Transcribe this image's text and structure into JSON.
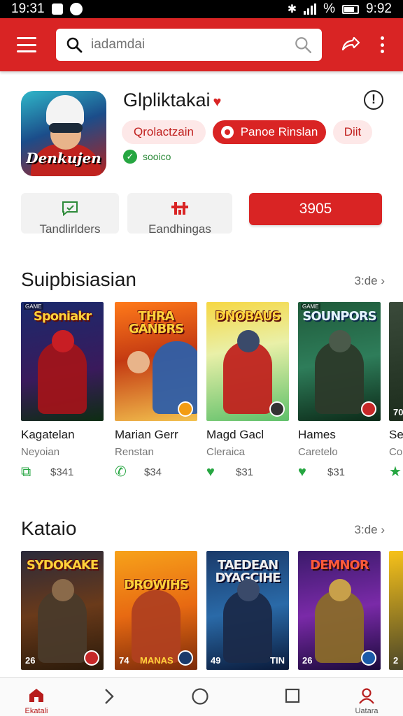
{
  "status_bar": {
    "time": "19:31",
    "battery_text": "%",
    "right_time": "9:92"
  },
  "search": {
    "placeholder": "iadamdai"
  },
  "app": {
    "name": "Glpliktakai",
    "icon_text": "Denkujen",
    "chips": [
      "Qrolactzain",
      "Panoe Rinslan",
      "Diit"
    ],
    "verified_label": "sooico"
  },
  "actions": [
    {
      "label": "Tandlirlders",
      "icon": "chat-icon"
    },
    {
      "label": "Eandhingas",
      "icon": "grid-icon"
    },
    {
      "label": "3905"
    }
  ],
  "sections": [
    {
      "title": "Suipbisiasian",
      "more": "3:de",
      "items": [
        {
          "cover_title": "Sponiakr",
          "name": "Kagatelan",
          "sub": "Neyoian",
          "price": "$341",
          "icon": "tablet-icon"
        },
        {
          "cover_title": "THRA GANBRS",
          "name": "Marian Gerr",
          "sub": "Renstan",
          "price": "$34",
          "icon": "phone-icon"
        },
        {
          "cover_title": "DNOBAUS",
          "name": "Magd Gacl",
          "sub": "Cleraica",
          "price": "$31",
          "icon": "heart-icon"
        },
        {
          "cover_title": "SOUNPORS",
          "name": "Hames",
          "sub": "Caretelo",
          "price": "$31",
          "icon": "heart-icon"
        },
        {
          "cover_title": "70",
          "name": "Se",
          "sub": "Co",
          "price": "",
          "icon": "star-icon"
        }
      ]
    },
    {
      "title": "Kataio",
      "more": "3:de",
      "items": [
        {
          "cover_title": "SYDOKAKE",
          "rank": "26",
          "icon": ""
        },
        {
          "cover_title": "DROWIHS",
          "rank": "74",
          "footer": "MANAS"
        },
        {
          "cover_title": "TAEDEAN DYAGCIHE",
          "rank": "49",
          "footer": "TIN"
        },
        {
          "cover_title": "DEMNOR",
          "rank": "26"
        },
        {
          "cover_title": "S",
          "rank": "2"
        }
      ]
    }
  ],
  "bottom_nav": [
    {
      "label": "Ekatali",
      "icon": "home-icon"
    },
    {
      "label": "",
      "icon": "chevron-right-icon"
    },
    {
      "label": "",
      "icon": "circle-icon"
    },
    {
      "label": "",
      "icon": "square-icon"
    },
    {
      "label": "Uatara",
      "icon": "profile-icon"
    }
  ],
  "colors": {
    "accent": "#d92424",
    "green": "#26a641"
  }
}
